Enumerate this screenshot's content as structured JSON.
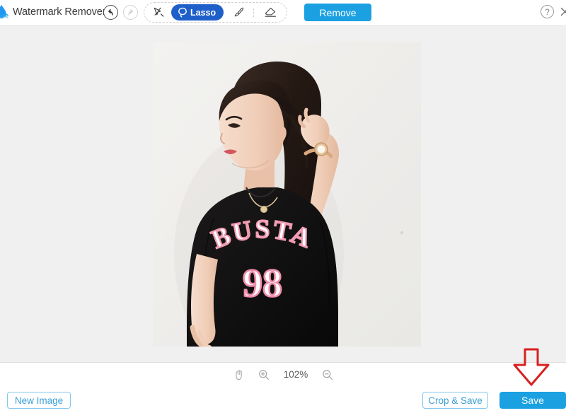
{
  "app": {
    "title": "Watermark Remover",
    "logo_icon": "water-drop-logo"
  },
  "header": {
    "undo": {
      "label": "Undo",
      "icon": "undo-arrow-icon",
      "enabled": true
    },
    "redo": {
      "label": "Redo",
      "icon": "redo-arrow-icon",
      "enabled": false
    },
    "tools": [
      {
        "id": "magic-select",
        "label": "Magic Select",
        "icon": "magic-wand-icon",
        "active": false
      },
      {
        "id": "lasso",
        "label": "Lasso",
        "icon": "lasso-icon",
        "active": true
      },
      {
        "id": "brush",
        "label": "Brush",
        "icon": "brush-icon",
        "active": false
      },
      {
        "id": "eraser",
        "label": "Eraser",
        "icon": "eraser-icon",
        "active": false
      }
    ],
    "remove_label": "Remove",
    "help_label": "?",
    "close_label": "×"
  },
  "canvas": {
    "image_alt": "Woman in black BUSTA 98 t-shirt posing with hand in hair",
    "shirt_text_top": "BUSTA",
    "shirt_text_number": "98"
  },
  "zoom_bar": {
    "pan_icon": "hand-pan-icon",
    "zoom_in_icon": "zoom-in-icon",
    "zoom_out_icon": "zoom-out-icon",
    "level": "102%"
  },
  "footer": {
    "new_image_label": "New Image",
    "crop_save_label": "Crop & Save",
    "save_label": "Save"
  },
  "annotation": {
    "arrow_icon": "red-down-arrow-annotation",
    "color": "#d82020",
    "points_to": "Save"
  },
  "colors": {
    "primary_blue": "#1ba1e2",
    "lasso_blue": "#1f5fc9",
    "outline_blue": "#84c8ee",
    "canvas_bg": "#f0f0f0",
    "annotation_red": "#d82020"
  }
}
